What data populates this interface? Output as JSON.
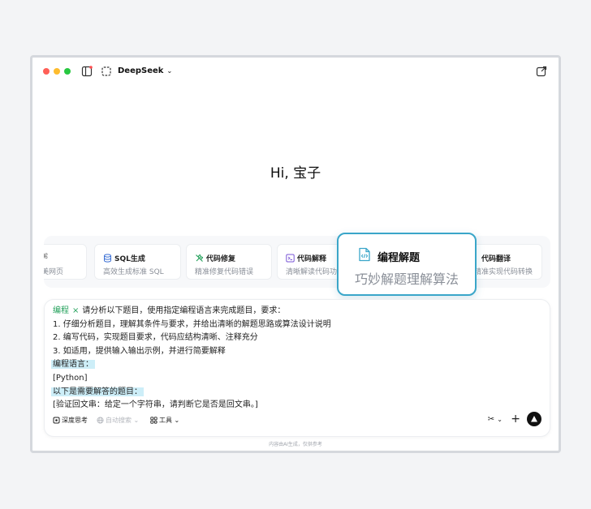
{
  "titlebar": {
    "app_name": "DeepSeek"
  },
  "greeting": "Hi, 宝子",
  "cards": [
    {
      "title": "",
      "subtitle": "美网页"
    },
    {
      "title": "SQL生成",
      "subtitle": "高效生成标准 SQL"
    },
    {
      "title": "代码修复",
      "subtitle": "精准修复代码错误"
    },
    {
      "title": "代码解释",
      "subtitle": "清晰解读代码功能"
    },
    {
      "title": "代码翻译",
      "subtitle": "精准实现代码转换"
    }
  ],
  "featured": {
    "title": "编程解题",
    "subtitle": "巧妙解题理解算法"
  },
  "prompt": {
    "tag": "编程",
    "line1": "请分析以下题目，使用指定编程语言来完成题目，要求：",
    "line2": "1. 仔细分析题目，理解其条件与要求，并给出清晰的解题思路或算法设计说明",
    "line3": "2. 编写代码，实现题目要求，代码应结构清晰、注释充分",
    "line4": "3. 如适用，提供输入输出示例，并进行简要解释",
    "line5": "编程语言：",
    "line6": "[Python]",
    "line7": "以下是需要解答的题目：",
    "line8": "[验证回文串：给定一个字符串，请判断它是否是回文串。]"
  },
  "toolbar": {
    "deep_think": "深度思考",
    "auto_search": "自动搜索",
    "tools": "工具"
  },
  "footer_note": "内容由AI生成，仅供参考",
  "colors": {
    "accent": "#3aa6c9",
    "tag_green": "#22a05a",
    "highlight": "#cdeef8"
  }
}
